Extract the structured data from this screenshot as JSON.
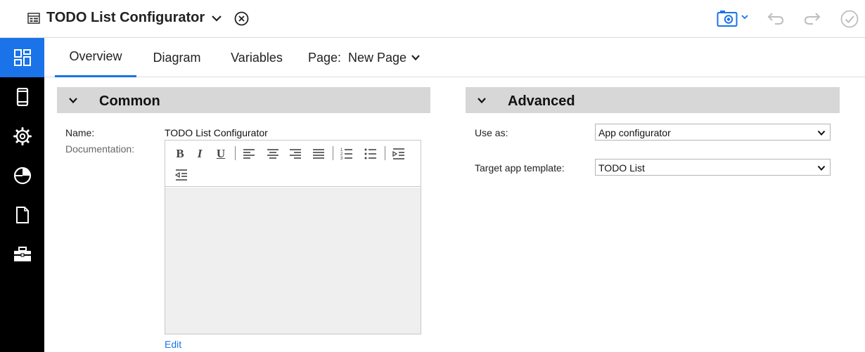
{
  "header": {
    "title": "TODO List Configurator",
    "icons": [
      "document-icon",
      "chevron-down-icon",
      "close-circle-icon",
      "camera-icon",
      "undo-icon",
      "redo-icon",
      "check-circle-icon"
    ],
    "accent_color": "#1a73e8"
  },
  "sidebar": {
    "items": [
      {
        "icon": "dashboard-icon",
        "active": true
      },
      {
        "icon": "mobile-icon",
        "active": false
      },
      {
        "icon": "gear-icon",
        "active": false
      },
      {
        "icon": "pie-chart-icon",
        "active": false
      },
      {
        "icon": "file-icon",
        "active": false
      },
      {
        "icon": "toolbox-icon",
        "active": false
      }
    ]
  },
  "tabs": [
    {
      "label": "Overview",
      "active": true
    },
    {
      "label": "Diagram",
      "active": false
    },
    {
      "label": "Variables",
      "active": false
    }
  ],
  "page_selector": {
    "label": "Page:",
    "value": "New Page"
  },
  "common": {
    "title": "Common",
    "name_label": "Name:",
    "name_value": "TODO List Configurator",
    "documentation_label": "Documentation:",
    "edit_label": "Edit",
    "toolbar_icons": [
      "bold-icon",
      "italic-icon",
      "underline-icon",
      "align-left-icon",
      "align-center-icon",
      "align-right-icon",
      "align-justify-icon",
      "ordered-list-icon",
      "unordered-list-icon",
      "indent-icon",
      "outdent-icon"
    ]
  },
  "advanced": {
    "title": "Advanced",
    "use_as_label": "Use as:",
    "use_as_value": "App configurator",
    "target_template_label": "Target app template:",
    "target_template_value": "TODO List"
  }
}
